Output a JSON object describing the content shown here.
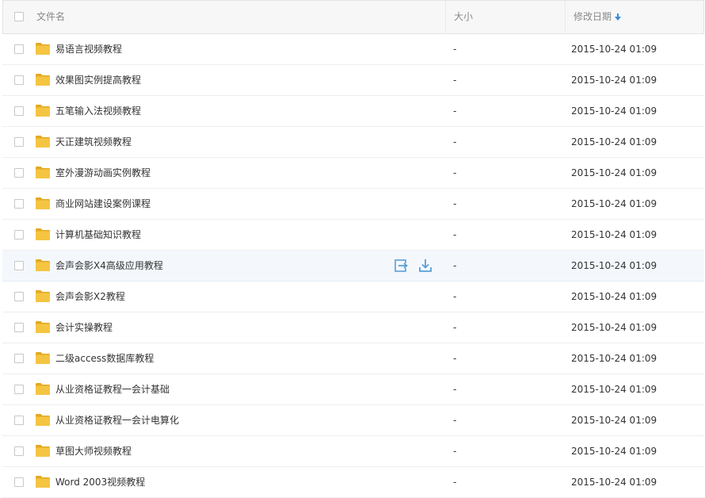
{
  "header": {
    "name_label": "文件名",
    "size_label": "大小",
    "date_label": "修改日期"
  },
  "rows": [
    {
      "name": "易语言视频教程",
      "size": "-",
      "date": "2015-10-24 01:09"
    },
    {
      "name": "效果图实例提高教程",
      "size": "-",
      "date": "2015-10-24 01:09"
    },
    {
      "name": "五笔输入法视频教程",
      "size": "-",
      "date": "2015-10-24 01:09"
    },
    {
      "name": "天正建筑视频教程",
      "size": "-",
      "date": "2015-10-24 01:09"
    },
    {
      "name": "室外漫游动画实例教程",
      "size": "-",
      "date": "2015-10-24 01:09"
    },
    {
      "name": "商业网站建设案例课程",
      "size": "-",
      "date": "2015-10-24 01:09"
    },
    {
      "name": "计算机基础知识教程",
      "size": "-",
      "date": "2015-10-24 01:09"
    },
    {
      "name": "会声会影X4高级应用教程",
      "size": "-",
      "date": "2015-10-24 01:09"
    },
    {
      "name": "会声会影X2教程",
      "size": "-",
      "date": "2015-10-24 01:09"
    },
    {
      "name": "会计实操教程",
      "size": "-",
      "date": "2015-10-24 01:09"
    },
    {
      "name": "二级access数据库教程",
      "size": "-",
      "date": "2015-10-24 01:09"
    },
    {
      "name": "从业资格证教程一会计基础",
      "size": "-",
      "date": "2015-10-24 01:09"
    },
    {
      "name": "从业资格证教程一会计电算化",
      "size": "-",
      "date": "2015-10-24 01:09"
    },
    {
      "name": "草图大师视频教程",
      "size": "-",
      "date": "2015-10-24 01:09"
    },
    {
      "name": "Word 2003视频教程",
      "size": "-",
      "date": "2015-10-24 01:09"
    }
  ],
  "hovered_row": 7,
  "hover_actions": [
    "share-icon",
    "download-icon"
  ],
  "colors": {
    "folder": "#f5c542",
    "folder_dark": "#e3a923",
    "accent": "#3b8bd6",
    "action_icon": "#5a9fd4"
  }
}
